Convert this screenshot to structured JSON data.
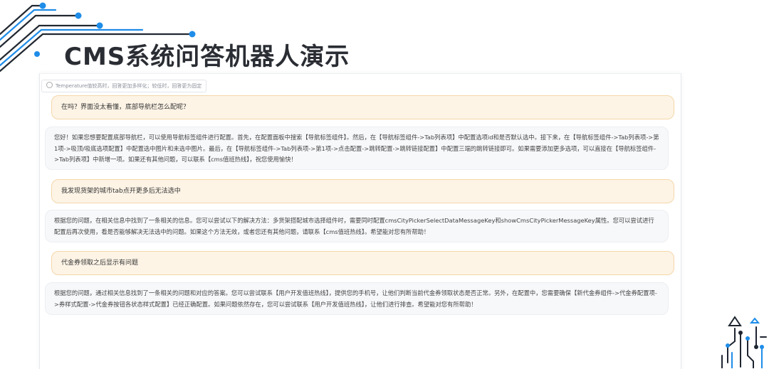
{
  "slide": {
    "title": "CMS系统问答机器人演示"
  },
  "chat": {
    "temperature_hint": "Temperature值较高时，回答更加多样化；较低时，回答更为固定",
    "messages": [
      {
        "role": "user",
        "text": "在吗？界面没太看懂，底部导航栏怎么配呢？"
      },
      {
        "role": "assistant",
        "text": "您好！如果您想要配置底部导航栏，可以使用导航标签组件进行配置。首先，在配置面板中搜索【导航标签组件】。然后，在【导航标签组件->Tab列表项】中配置选项id和是否默认选中。接下来，在【导航标签组件->Tab列表项->第1项->吸顶/吸底选项配置】中配置选中图片和未选中图片。最后，在【导航标签组件->Tab列表项->第1项->点击配置->跳转配置->跳转链接配置】中配置三端的跳转链接即可。如果需要添加更多选项，可以直接在【导航标签组件->Tab列表项】中新增一项。如果还有其他问题，可以联系【cms值班热线】，祝您使用愉快！"
      },
      {
        "role": "user",
        "text": "我发现货架的城市tab点开更多后无法选中"
      },
      {
        "role": "assistant",
        "text": "根据您的问题，在相关信息中找到了一条相关的信息。您可以尝试以下的解决方法：多货架搭配城市选择组件时，需要同时配置cmsCityPickerSelectDataMessageKey和showCmsCityPickerMessageKey属性。您可以尝试进行配置后再次使用，看是否能够解决无法选中的问题。如果这个方法无效，或者您还有其他问题，请联系【cms值班热线】。希望能对您有所帮助！"
      },
      {
        "role": "user",
        "text": "代金券领取之后显示有问题"
      },
      {
        "role": "assistant",
        "text": "根据您的问题，通过相关信息找到了一条相关的问题和对应的答案。您可以尝试联系【用户开发值班热线】，提供您的手机号，让他们判断当前代金券领取状态是否正常。另外，在配置中，您需要确保【新代金券组件->代金券配置项->券样式配置->代金券按钮各状态样式配置】已经正确配置。如果问题依然存在，您可以尝试联系【用户开发值班热线】，让他们进行排查。希望能对您有所帮助！"
      }
    ]
  },
  "colors": {
    "accent_blue": "#1f8de8",
    "user_bubble_bg": "#fdf4e6",
    "user_bubble_border": "#f4d7a8",
    "bot_bubble_bg": "#f7f8fa"
  },
  "icons": [
    "circuit-lines-decoration",
    "circuit-logo-icon"
  ]
}
